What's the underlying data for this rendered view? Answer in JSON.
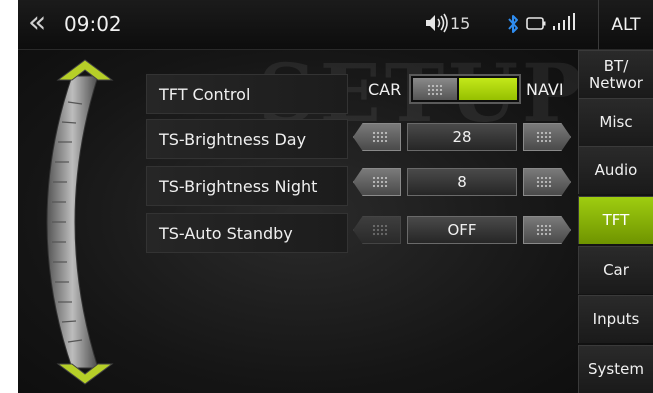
{
  "status_bar": {
    "back_glyph": "«",
    "time": "09:02",
    "volume": "15",
    "alt_label": "ALT"
  },
  "watermark": "SETUP",
  "settings": {
    "tft_control": {
      "label": "TFT Control",
      "option_left": "CAR",
      "option_right": "NAVI",
      "selected": "NAVI"
    },
    "brightness_day": {
      "label": "TS-Brightness Day",
      "value": "28"
    },
    "brightness_night": {
      "label": "TS-Brightness Night",
      "value": "8"
    },
    "auto_standby": {
      "label": "TS-Auto Standby",
      "value": "OFF"
    }
  },
  "tabs": [
    {
      "label": "BT/\nNetwor",
      "active": false
    },
    {
      "label": "Misc",
      "active": false
    },
    {
      "label": "Audio",
      "active": false
    },
    {
      "label": "TFT",
      "active": true
    },
    {
      "label": "Car",
      "active": false
    },
    {
      "label": "Inputs",
      "active": false
    },
    {
      "label": "System",
      "active": false
    }
  ],
  "colors": {
    "accent": "#9fcd10",
    "background": "#151515"
  },
  "icons": [
    "back-icon",
    "volume-icon",
    "bluetooth-icon",
    "battery-icon",
    "signal-icon"
  ]
}
